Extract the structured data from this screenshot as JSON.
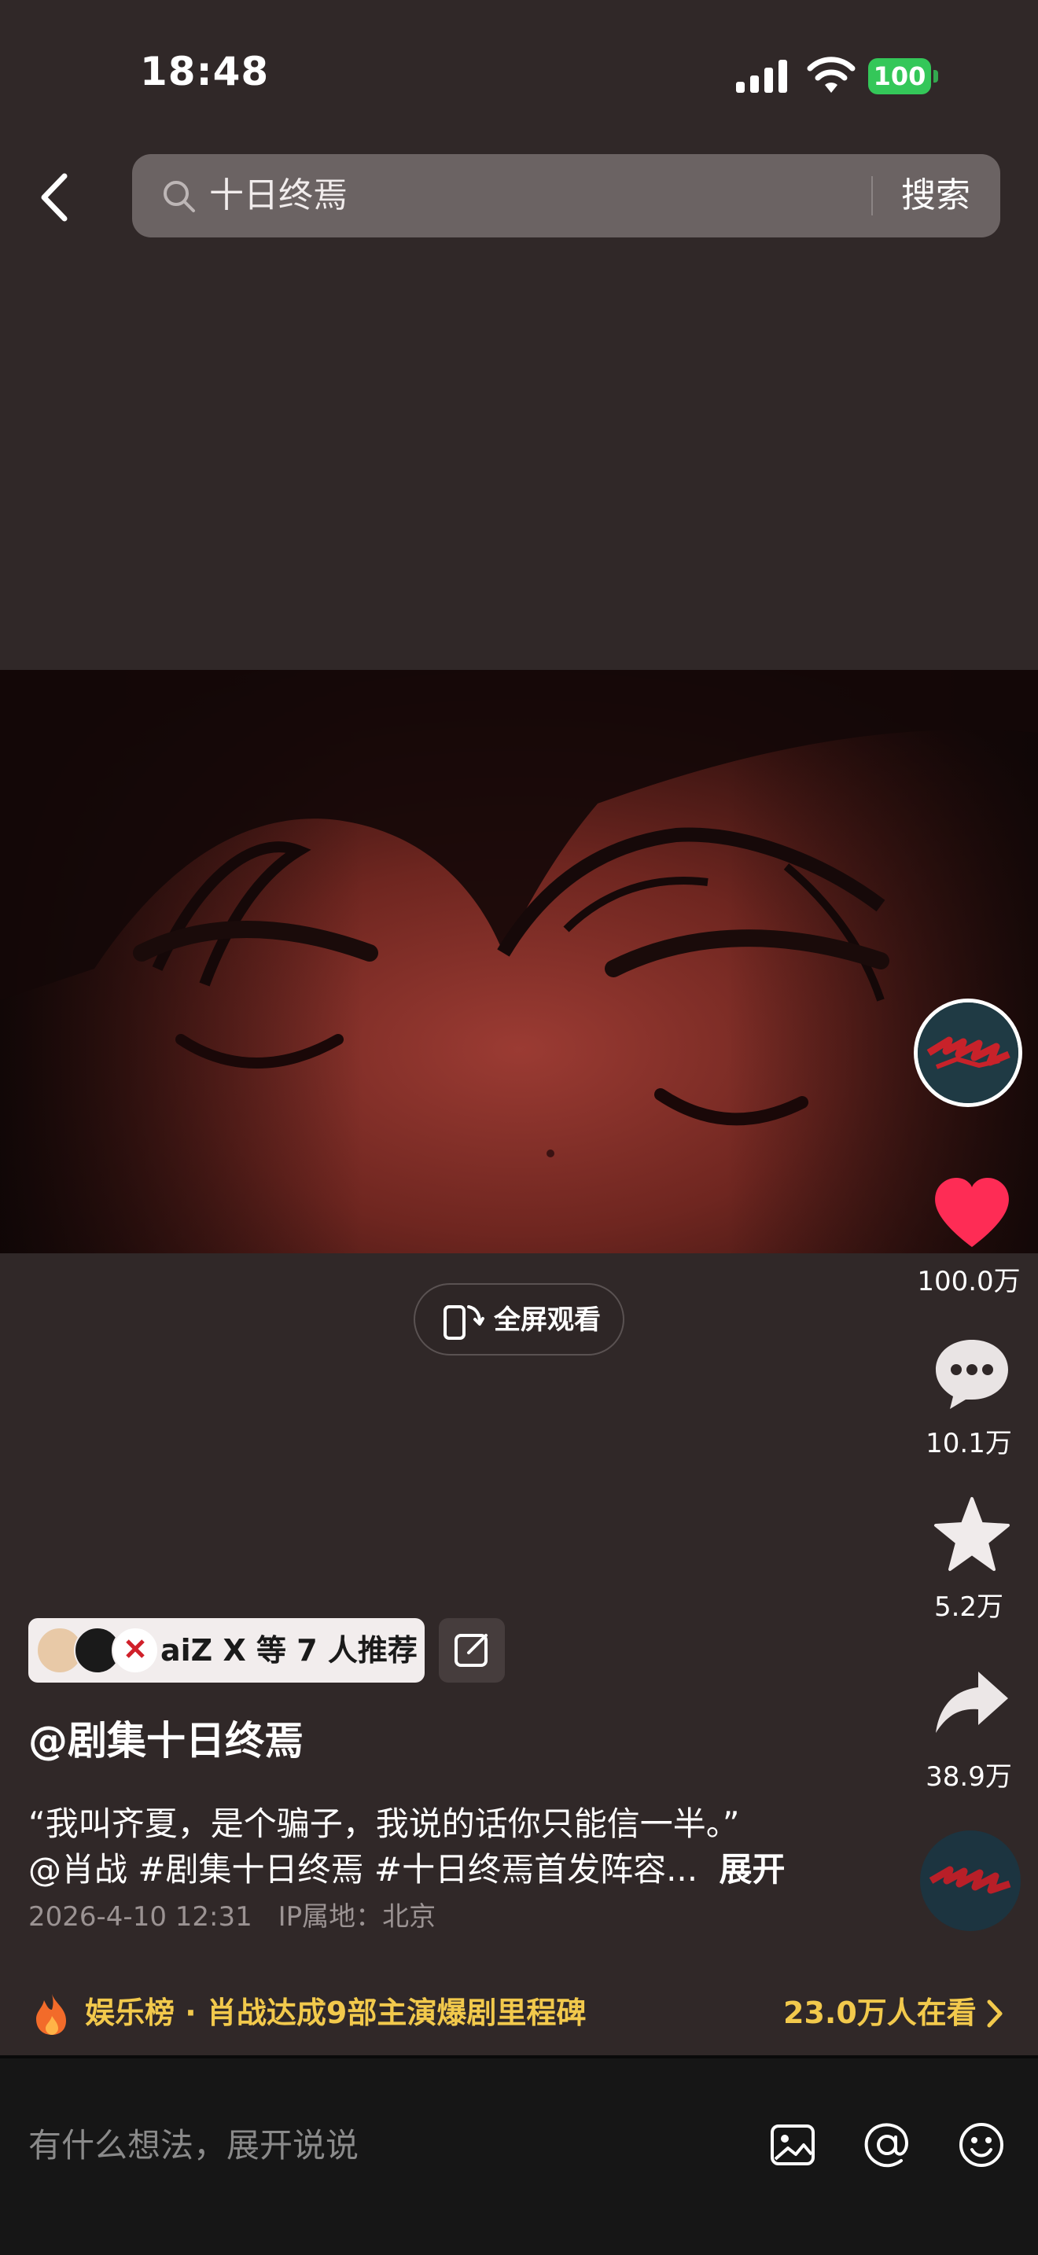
{
  "status_bar": {
    "time": "18:48",
    "battery": "100"
  },
  "search": {
    "query": "十日终焉",
    "button": "搜索"
  },
  "fullscreen": {
    "label": "全屏观看"
  },
  "rail": {
    "likes": "100.0万",
    "comments": "10.1万",
    "favorites": "5.2万",
    "shares": "38.9万"
  },
  "recommend": {
    "text": "aiZ  X 等 7 人推荐"
  },
  "post": {
    "author": "@剧集十日终焉",
    "line1": "“我叫齐夏，是个骗子，我说的话你只能信一半。”",
    "line2": "@肖战 #剧集十日终焉 #十日终焉首发阵容...",
    "expand": "展开",
    "date": "2026-4-10 12:31",
    "ip": "IP属地：北京"
  },
  "hot": {
    "text": "娱乐榜 · 肖战达成9部主演爆剧里程碑",
    "count": "23.0万人在看"
  },
  "comment": {
    "placeholder": "有什么想法，展开说说"
  },
  "colors": {
    "accent_yellow": "#f2c94c",
    "like_red": "#fe2c55",
    "battery_green": "#34c759"
  }
}
